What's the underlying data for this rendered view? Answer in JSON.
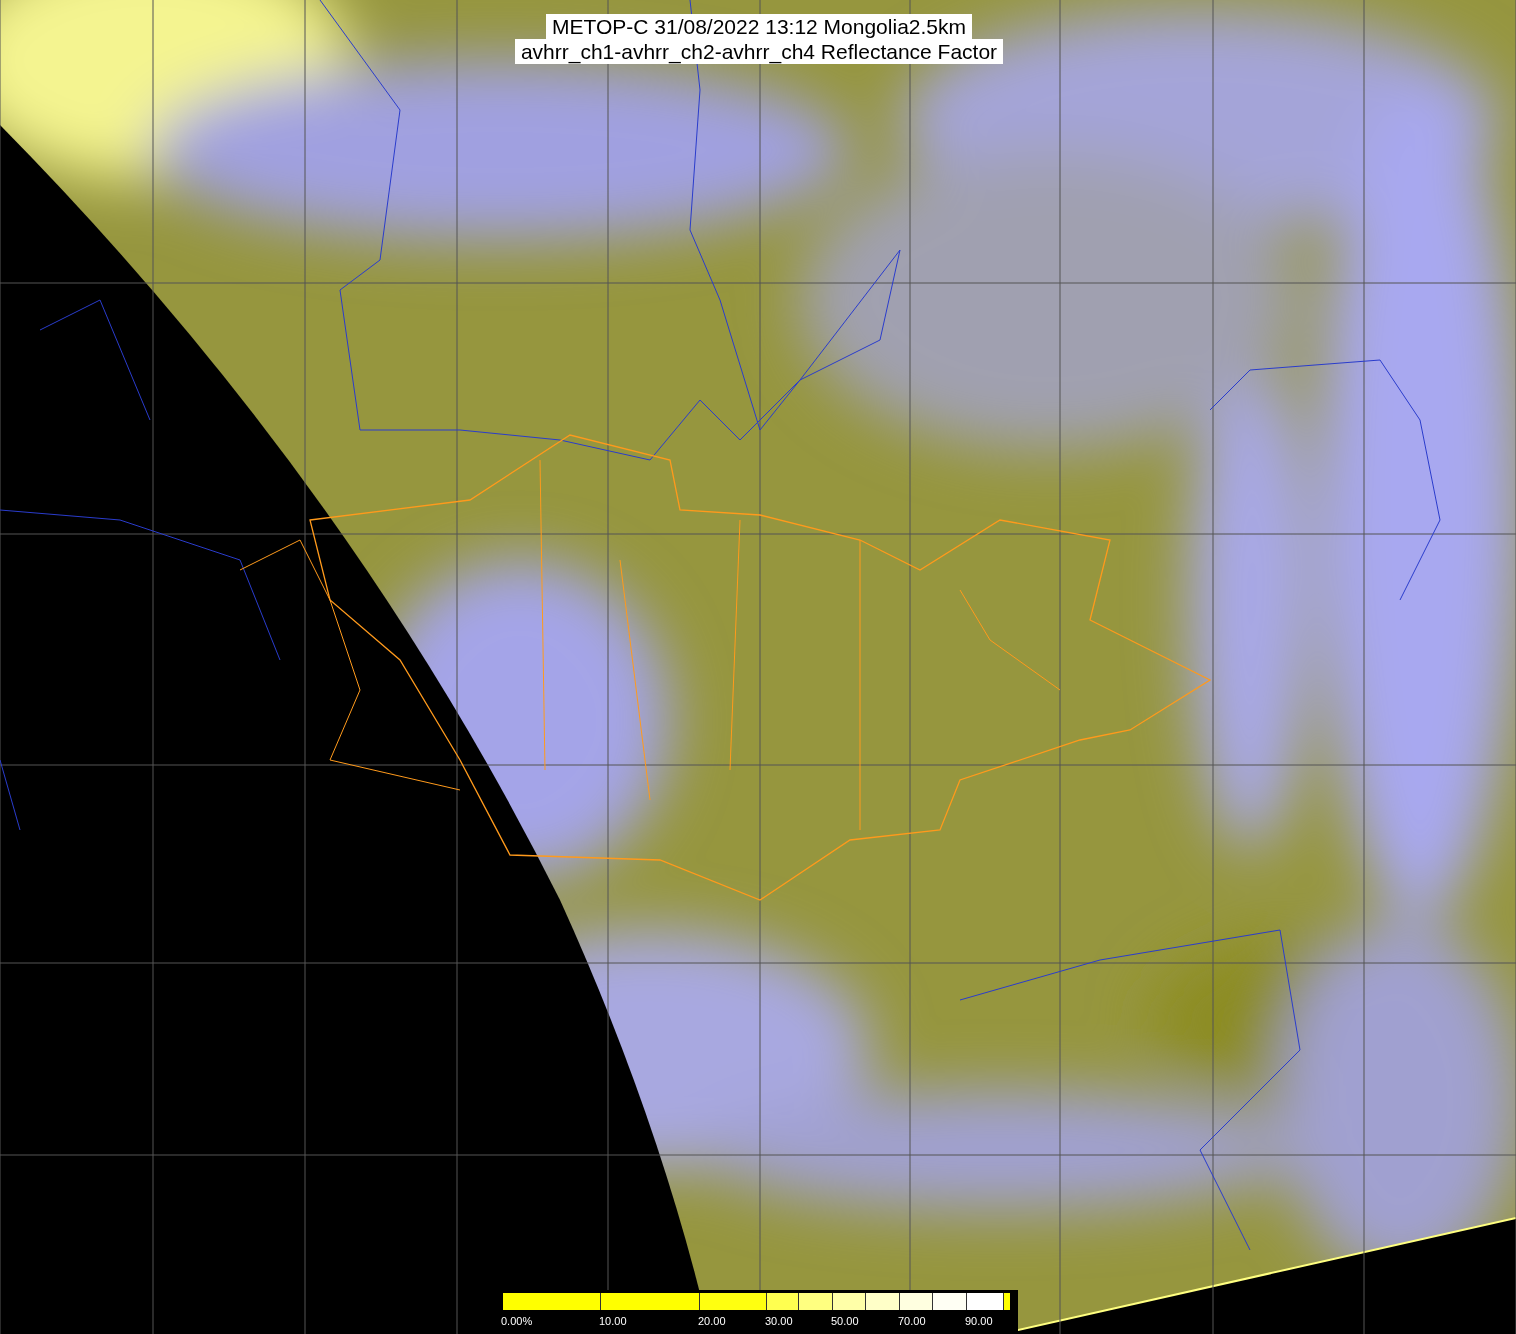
{
  "title": {
    "lines": [
      "METOP-C 31/08/2022 13:12 Mongolia2.5km",
      "avhrr_ch1-avhrr_ch2-avhrr_ch4 Reflectance Factor"
    ]
  },
  "legend": {
    "labels": [
      "0.00%",
      "10.00",
      "20.00",
      "30.00",
      "50.00",
      "70.00",
      "90.00"
    ]
  }
}
